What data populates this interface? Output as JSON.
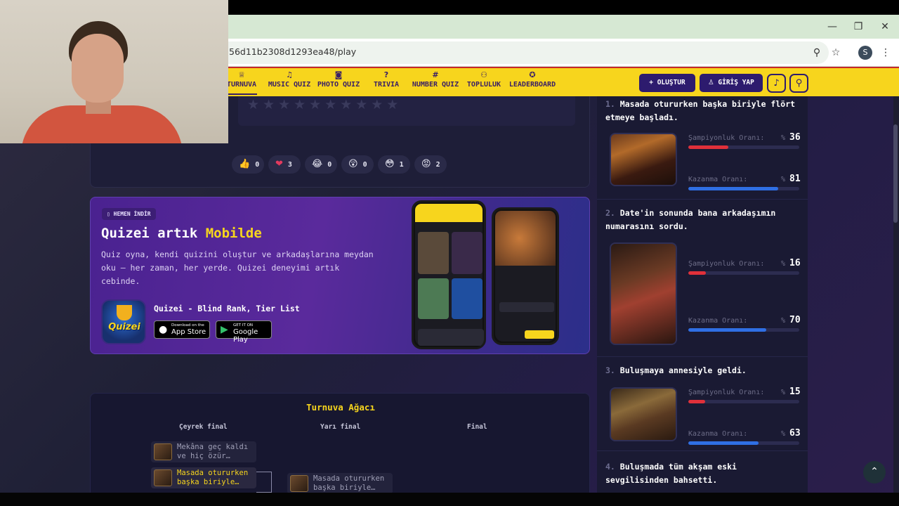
{
  "browser": {
    "url": "56d11b2308d1293ea48/play",
    "profile_initial": "S",
    "icons": [
      "minimize-icon",
      "restore-icon",
      "close-icon",
      "zoom-icon",
      "bookmark-star-icon",
      "menu-dots-icon"
    ],
    "glyphs": {
      "minimize": "—",
      "restore": "❐",
      "close": "✕",
      "zoom": "⚲",
      "star": "☆",
      "menu": "⋮"
    }
  },
  "nav": {
    "items": [
      {
        "label": "TURNUVA",
        "icon": "trophy-icon",
        "glyph": "♕"
      },
      {
        "label": "MUSIC QUIZ",
        "icon": "music-note-icon",
        "glyph": "♫"
      },
      {
        "label": "PHOTO QUIZ",
        "icon": "camera-icon",
        "glyph": "◙"
      },
      {
        "label": "TRIVIA",
        "icon": "question-icon",
        "glyph": "?"
      },
      {
        "label": "NUMBER QUIZ",
        "icon": "hash-icon",
        "glyph": "#"
      },
      {
        "label": "TOPLULUK",
        "icon": "people-icon",
        "glyph": "⚇"
      },
      {
        "label": "LEADERBOARD",
        "icon": "medal-icon",
        "glyph": "✪"
      }
    ],
    "create_label": "+ OLUŞTUR",
    "login_label": "GİRİŞ YAP",
    "login_glyph": "♙",
    "bell_glyph": "♪",
    "search_glyph": "⚲",
    "colors": {
      "bar": "#f7d51d",
      "accent": "#2d1b6e"
    }
  },
  "rating": {
    "stars": "★★★★★★★★★★"
  },
  "reactions": [
    {
      "emoji": "👍",
      "icon": "thumbs-up-icon",
      "count": "0"
    },
    {
      "emoji": "❤",
      "icon": "heart-icon",
      "count": "3"
    },
    {
      "emoji": "😂",
      "icon": "laugh-icon",
      "count": "0"
    },
    {
      "emoji": "😲",
      "icon": "surprised-icon",
      "count": "0"
    },
    {
      "emoji": "😳",
      "icon": "flushed-icon",
      "count": "1"
    },
    {
      "emoji": "😡",
      "icon": "angry-icon",
      "count": "2"
    }
  ],
  "banner": {
    "badge": "HEMEN İNDİR",
    "title_prefix": "Quizei artık ",
    "title_highlight": "Mobilde",
    "description": "Quiz oyna, kendi quizini oluştur ve arkadaşlarına meydan oku — her zaman, her yerde. Quizei deneyimi artık cebinde.",
    "app_name": "Quizei - Blind Rank, Tier List",
    "app_icon_text": "Quizei",
    "app_store": {
      "small": "Download on the",
      "big": "App Store"
    },
    "google_play": {
      "small": "GET IT ON",
      "big": "Google Play"
    }
  },
  "tree": {
    "title": "Turnuva Ağacı",
    "rounds": [
      "Çeyrek final",
      "Yarı final",
      "Final"
    ],
    "matches": [
      {
        "text": "Mekâna geç kaldı ve hiç özür…"
      },
      {
        "text": "Masada otururken başka biriyle…"
      },
      {
        "text": "Masada otururken başka biriyle…"
      }
    ]
  },
  "sidebar": {
    "items": [
      {
        "num": "1.",
        "question": "Masada otururken başka biriyle flört etmeye başladı.",
        "champ_label": "Şampiyonluk Oranı:",
        "champ": 36,
        "win_label": "Kazanma Oranı:",
        "win": 81
      },
      {
        "num": "2.",
        "question": "Date'in sonunda bana arkadaşımın numarasını sordu.",
        "champ_label": "Şampiyonluk Oranı:",
        "champ": 16,
        "win_label": "Kazanma Oranı:",
        "win": 70
      },
      {
        "num": "3.",
        "question": "Buluşmaya annesiyle geldi.",
        "champ_label": "Şampiyonluk Oranı:",
        "champ": 15,
        "win_label": "Kazanma Oranı:",
        "win": 63
      },
      {
        "num": "4.",
        "question": "Buluşmada tüm akşam eski sevgilisinden bahsetti."
      }
    ],
    "pct_sign": "%",
    "colors": {
      "champ_bar": "#e0303a",
      "win_bar": "#2f6fe4"
    }
  },
  "scroll_top_glyph": "⌃"
}
